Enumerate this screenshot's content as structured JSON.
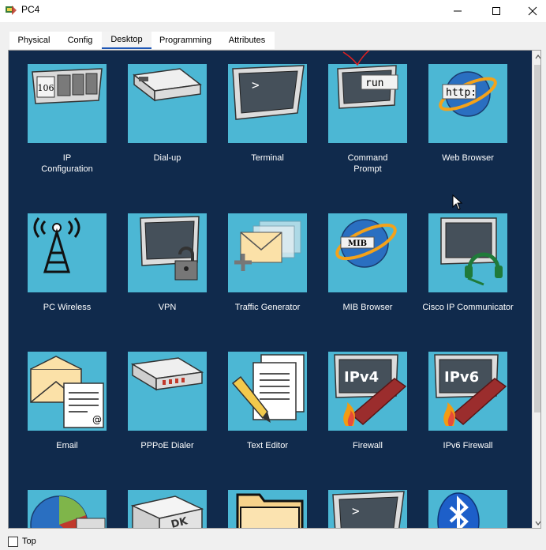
{
  "window": {
    "title": "PC4",
    "controls": [
      "minimize",
      "maximize",
      "close"
    ]
  },
  "tabs": [
    {
      "label": "Physical",
      "active": false
    },
    {
      "label": "Config",
      "active": false
    },
    {
      "label": "Desktop",
      "active": true
    },
    {
      "label": "Programming",
      "active": false
    },
    {
      "label": "Attributes",
      "active": false
    }
  ],
  "desktop": {
    "apps": [
      {
        "label": "IP\nConfiguration",
        "icon": "ip-configuration-icon",
        "ip_number": "106"
      },
      {
        "label": "Dial-up",
        "icon": "modem-icon"
      },
      {
        "label": "Terminal",
        "icon": "terminal-icon",
        "glyph": ">"
      },
      {
        "label": "Command\nPrompt",
        "icon": "command-prompt-icon",
        "glyph": "run"
      },
      {
        "label": "Web Browser",
        "icon": "web-browser-icon",
        "glyph": "http:"
      },
      {
        "label": "PC Wireless",
        "icon": "wireless-tower-icon"
      },
      {
        "label": "VPN",
        "icon": "vpn-lock-icon"
      },
      {
        "label": "Traffic Generator",
        "icon": "traffic-generator-icon"
      },
      {
        "label": "MIB Browser",
        "icon": "mib-browser-icon",
        "glyph": "MIB"
      },
      {
        "label": "Cisco IP Communicator",
        "icon": "ip-communicator-icon"
      },
      {
        "label": "Email",
        "icon": "email-icon"
      },
      {
        "label": "PPPoE Dialer",
        "icon": "pppoe-dialer-icon"
      },
      {
        "label": "Text Editor",
        "icon": "text-editor-icon"
      },
      {
        "label": "Firewall",
        "icon": "firewall-icon",
        "glyph": "IPv4"
      },
      {
        "label": "IPv6 Firewall",
        "icon": "ipv6-firewall-icon",
        "glyph": "IPv6"
      },
      {
        "label": "",
        "icon": "pie-chart-icon"
      },
      {
        "label": "",
        "icon": "sdk-box-icon",
        "glyph": "DK"
      },
      {
        "label": "",
        "icon": "folder-icon"
      },
      {
        "label": "",
        "icon": "terminal-icon",
        "glyph": ">"
      },
      {
        "label": "",
        "icon": "bluetooth-icon"
      }
    ]
  },
  "bottom": {
    "top_label": "Top",
    "top_checked": false
  },
  "colors": {
    "desktop_bg": "#102a4c",
    "tile_bg": "#4cb7d4",
    "tab_active_underline": "#1d56b5"
  }
}
